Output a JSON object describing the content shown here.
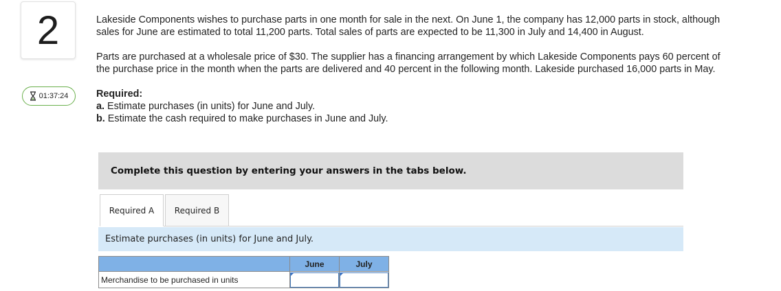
{
  "question": {
    "number": "2"
  },
  "timer": {
    "value": "01:37:24",
    "icon": "hourglass-icon"
  },
  "problem": {
    "paragraph1": "Lakeside Components wishes to purchase parts in one month for sale in the next. On June 1, the company has 12,000 parts in stock, although sales for June are estimated to total 11,200 parts. Total sales of parts are expected to be 11,300 in July and 14,400 in August.",
    "paragraph2": "Parts are purchased at a wholesale price of $30. The supplier has a financing arrangement by which Lakeside Components pays 60 percent of the purchase price in the month when the parts are delivered and 40 percent in the following month. Lakeside purchased 16,000 parts in May.",
    "required_title": "Required:",
    "req_a_letter": "a.",
    "req_a_text": " Estimate purchases (in units) for June and July.",
    "req_b_letter": "b.",
    "req_b_text": " Estimate the cash required to make purchases in June and July."
  },
  "instruction": "Complete this question by entering your answers in the tabs below.",
  "tabs": [
    {
      "label": "Required A",
      "active": true
    },
    {
      "label": "Required B",
      "active": false
    }
  ],
  "panel": {
    "header": "Estimate purchases (in units) for June and July.",
    "table": {
      "columns": [
        "June",
        "July"
      ],
      "row_label": "Merchandise to be purchased in units",
      "values": [
        "",
        ""
      ]
    }
  },
  "colors": {
    "timer_border": "#6ab04c",
    "instruction_bg": "#dcdcdc",
    "panel_header_bg": "#d6e9f8",
    "table_header_bg": "#7fb1e6"
  }
}
